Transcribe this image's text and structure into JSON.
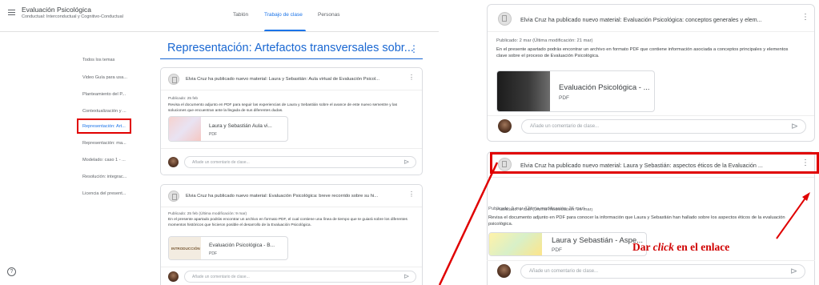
{
  "left_panel": {
    "app_title": "Evaluación Psicológica",
    "app_subtitle": "Conductual: Interconductual y Cognitivo-Conductual",
    "tabs": [
      "Tablón",
      "Trabajo de clase",
      "Personas"
    ],
    "active_tab": "Trabajo de clase",
    "sidebar": [
      "Todos los temas",
      "Video Guía para usa...",
      "Planteamiento del P...",
      "Contextualización y ...",
      "Representación: Art...",
      "Representación: ma...",
      "Modelado: caso 1 - ...",
      "Resolución: integrac...",
      "Licencia del present..."
    ],
    "active_sidebar": "Representación: Art...",
    "section_title": "Representación: Artefactos transversales sobr...",
    "posts": [
      {
        "title": "Elvia Cruz ha publicado nuevo material: Laura y Sebastián: Aula virtual de Evaluación Psicol...",
        "meta": "Publicado: 25 feb",
        "body": "Revisa el documento adjunto en PDF para seguir las experiencias de Laura y Sebastián sobre el avance de este nuevo semestre y las soluciones que encuentran ante la llegada de sus diferentes dudas.",
        "attachment_title": "Laura y Sebastián Aula vi...",
        "attachment_type": "PDF",
        "comment_placeholder": "Añade un comentario de clase..."
      },
      {
        "title": "Elvia Cruz ha publicado nuevo material: Evaluación Psicológica: breve recorrido sobre su hi...",
        "meta": "Publicado: 25 feb (Última modificación: 9 mar)",
        "body": "En el presente apartado podrás encontrar un archivo en formato PDF, el cual contiene una línea de tiempo que te guiará sobre los diferentes momentos históricos que hicieron posible el desarrollo de la Evaluación Psicológica.",
        "attachment_title": "Evaluación Psicológica - B...",
        "attachment_type": "PDF",
        "thumb_label": "INTRODUCCIÓN",
        "comment_placeholder": "Añade un comentario de clase..."
      }
    ],
    "help_glyph": "?"
  },
  "right_panel": {
    "posts": [
      {
        "title": "Elvia Cruz ha publicado nuevo material: Evaluación Psicológica: conceptos generales y elem...",
        "meta": "Publicado: 2 mar (Última modificación: 21 mar)",
        "body": "En el presente apartado podrás encontrar un archivo en formato PDF que contiene información asociada a conceptos principales y elementos clave sobre el proceso de Evaluación Psicológica.",
        "attachment_title": "Evaluación Psicológica - ...",
        "attachment_type": "PDF",
        "comment_placeholder": "Añade un comentario de clase..."
      },
      {
        "title": "Elvia Cruz ha publicado nuevo material: Laura y Sebastián: aspectos éticos de la Evaluación ...",
        "meta": "Publicado: 9 mar (Última modificación: 26 mar)",
        "body": "Revisa el documento adjunto en PDF para conocer la información que Laura y Sebastián han hallado sobre los aspectos éticos de la evaluación psicológica.",
        "attachment_title": "Laura y Sebastián - Aspe...",
        "attachment_type": "PDF",
        "comment_placeholder": "Añade un comentario de clase..."
      }
    ],
    "annotation_prefix": "Dar ",
    "annotation_italic": "click",
    "annotation_suffix": " en el enlace"
  },
  "colors": {
    "accent_blue": "#1a73e8",
    "highlight_red": "#e00000",
    "border_gray": "#dadce0"
  }
}
